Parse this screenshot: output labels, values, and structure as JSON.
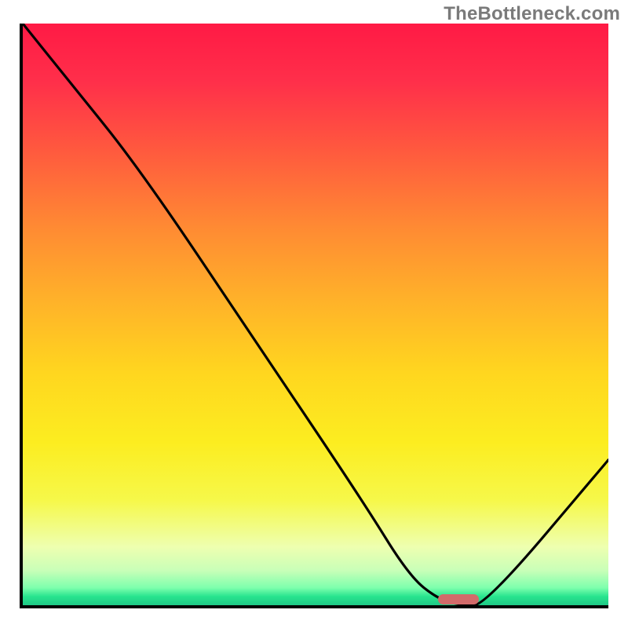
{
  "watermark": "TheBottleneck.com",
  "colors": {
    "axis": "#000000",
    "curve": "#000000",
    "pill": "#d26a6a",
    "gradient_top": "#ff1a45",
    "gradient_bottom": "#1ec986"
  },
  "chart_data": {
    "type": "line",
    "title": "",
    "xlabel": "",
    "ylabel": "",
    "xlim": [
      0,
      100
    ],
    "ylim": [
      0,
      100
    ],
    "series": [
      {
        "name": "bottleneck-curve",
        "x": [
          0,
          8,
          20,
          40,
          58,
          66,
          71,
          75,
          79,
          100
        ],
        "y": [
          100,
          90,
          75,
          45,
          18,
          5,
          1,
          0,
          0,
          25
        ]
      }
    ],
    "marker": {
      "name": "optimal-range",
      "x_center": 74,
      "y": 1.5,
      "width_pct": 7,
      "height_pct": 1.7
    },
    "background": {
      "type": "vertical-gradient",
      "stops": [
        {
          "pos": 0,
          "color": "#ff1a45"
        },
        {
          "pos": 0.35,
          "color": "#ff8a33"
        },
        {
          "pos": 0.6,
          "color": "#ffd61f"
        },
        {
          "pos": 0.82,
          "color": "#f6f84a"
        },
        {
          "pos": 0.97,
          "color": "#7dffad"
        },
        {
          "pos": 1.0,
          "color": "#1ec986"
        }
      ]
    }
  }
}
